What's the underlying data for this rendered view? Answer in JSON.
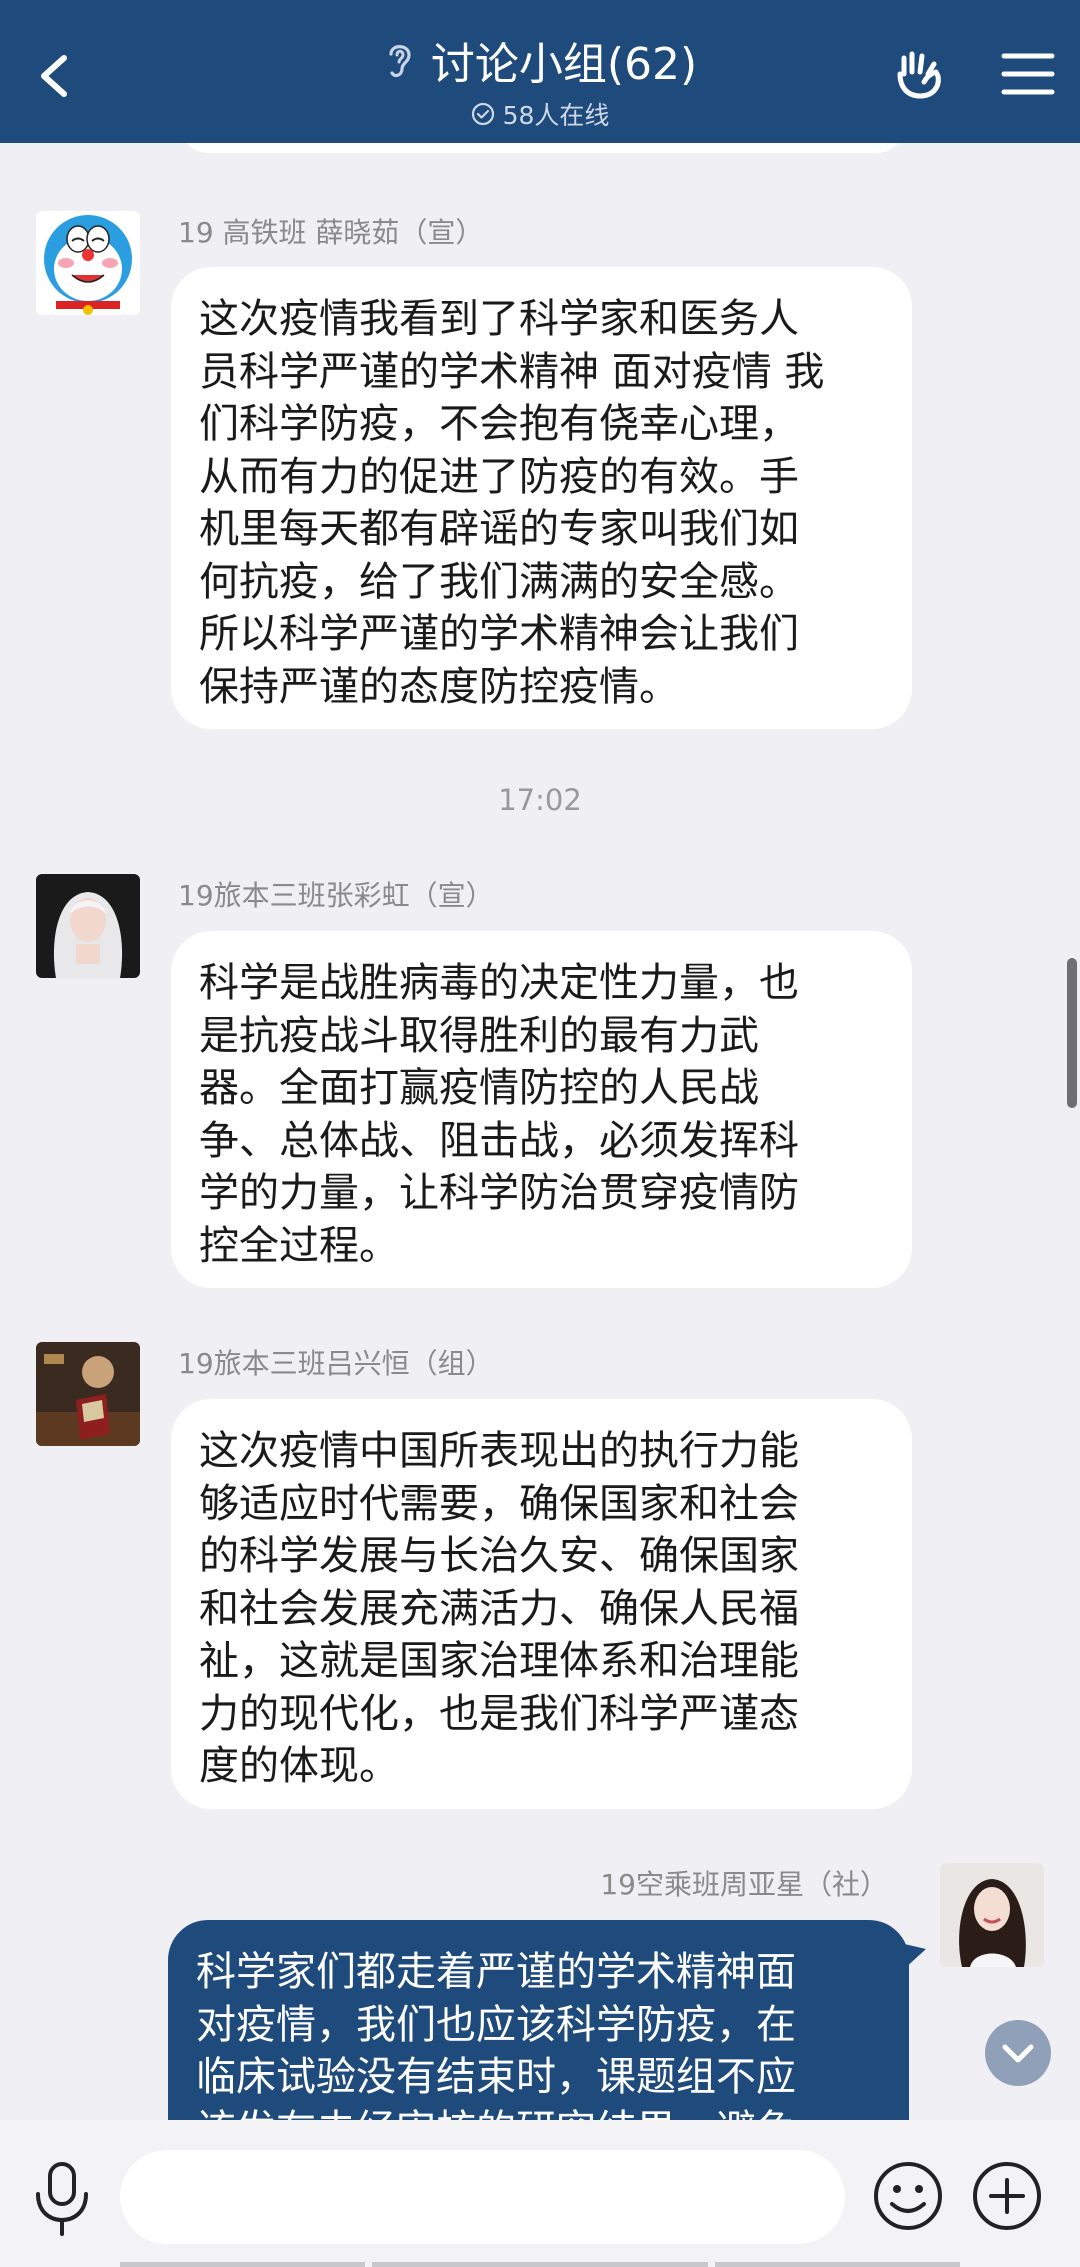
{
  "header": {
    "title": "讨论小组(62)",
    "online_status": "58人在线",
    "icons": {
      "back": "chevron-left-icon",
      "listen": "ear-icon",
      "online": "check-circle-icon",
      "hand": "raise-hand-icon",
      "menu": "menu-icon"
    }
  },
  "messages": [
    {
      "sender": "19 高铁班 薛晓茹（宣）",
      "text": "这次疫情我看到了科学家和医务人员科学严谨的学术精神 面对疫情 我们科学防疫，不会抱有侥幸心理，从而有力的促进了防疫的有效。手机里每天都有辟谣的专家叫我们如何抗疫，给了我们满满的安全感。所以科学严谨的学术精神会让我们保持严谨的态度防控疫情。",
      "lines": [
        "这次疫情我看到了科学家和医务人",
        "员科学严谨的学术精神 面对疫情 我",
        "们科学防疫，不会抱有侥幸心理，",
        "从而有力的促进了防疫的有效。手",
        "机里每天都有辟谣的专家叫我们如",
        "何抗疫，给了我们满满的安全感。",
        "所以科学严谨的学术精神会让我们",
        "保持严谨的态度防控疫情。"
      ]
    },
    {
      "timestamp": "17:02"
    },
    {
      "sender": "19旅本三班张彩虹（宣）",
      "lines": [
        "科学是战胜病毒的决定性力量，也",
        "是抗疫战斗取得胜利的最有力武",
        "器。全面打赢疫情防控的人民战",
        "争、总体战、阻击战，必须发挥科",
        "学的力量，让科学防治贯穿疫情防",
        "控全过程。"
      ]
    },
    {
      "sender": "19旅本三班吕兴恒（组）",
      "lines": [
        "这次疫情中国所表现出的执行力能",
        "够适应时代需要，确保国家和社会",
        "的科学发展与长治久安、确保国家",
        "和社会发展充满活力、确保人民福",
        "祉，这就是国家治理体系和治理能",
        "力的现代化，也是我们科学严谨态",
        "度的体现。"
      ]
    },
    {
      "sender": "19空乘班周亚星（社）",
      "lines": [
        "科学家们都走着严谨的学术精神面",
        "对疫情，我们也应该科学防疫，在",
        "临床试验没有结束时，课题组不应",
        "该发布未经审核的研究结果，避免"
      ]
    }
  ],
  "input_bar": {
    "placeholder": "",
    "icons": {
      "mic": "microphone-icon",
      "emoji": "emoji-icon",
      "plus": "plus-icon"
    }
  }
}
